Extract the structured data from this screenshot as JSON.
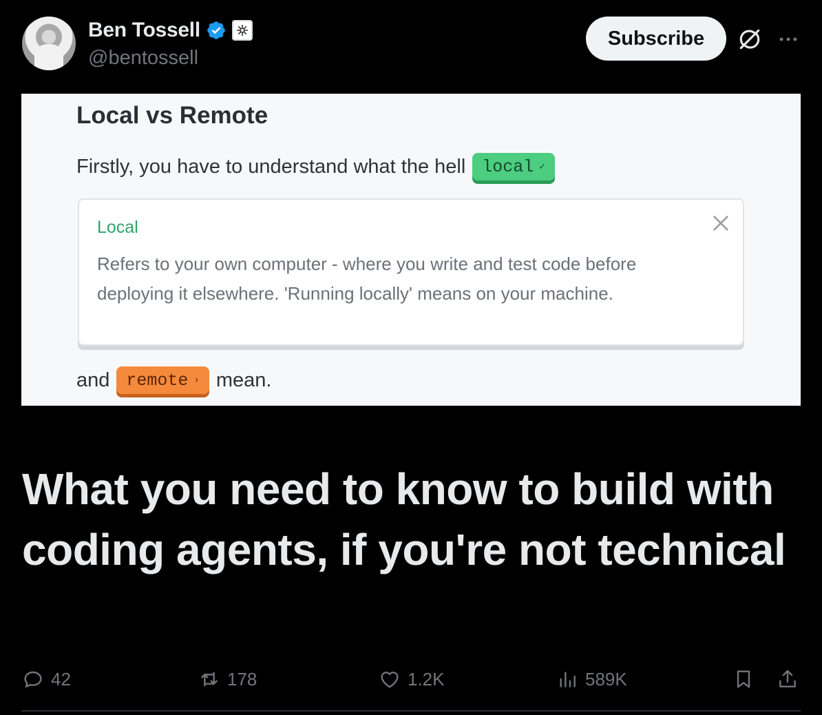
{
  "author": {
    "display_name": "Ben Tossell",
    "handle": "@bentossell"
  },
  "header": {
    "subscribe_label": "Subscribe"
  },
  "card": {
    "title": "Local vs Remote",
    "line1_text": "Firstly, you have to understand what the hell",
    "chip_local": "local",
    "chip_local_mark": "✓",
    "definition_term": "Local",
    "definition_text": "Refers to your own computer - where you write and test code before deploying it elsewhere. 'Running locally' means on your machine.",
    "line2_prefix": "and",
    "chip_remote": "remote",
    "chip_remote_mark": "›",
    "line2_suffix": "mean."
  },
  "article": {
    "title": "What you need to know to build with coding agents, if you're not technical"
  },
  "actions": {
    "replies": "42",
    "reposts": "178",
    "likes": "1.2K",
    "views": "589K"
  },
  "colors": {
    "background": "#000000",
    "local_chip": "#4ccd80",
    "remote_chip": "#f58a3c",
    "verified": "#1d9bf0"
  },
  "icons": [
    "verified-badge-icon",
    "affiliate-badge-icon",
    "grok-icon",
    "more-icon",
    "close-icon",
    "reply-icon",
    "repost-icon",
    "like-icon",
    "views-icon",
    "bookmark-icon",
    "share-icon"
  ]
}
